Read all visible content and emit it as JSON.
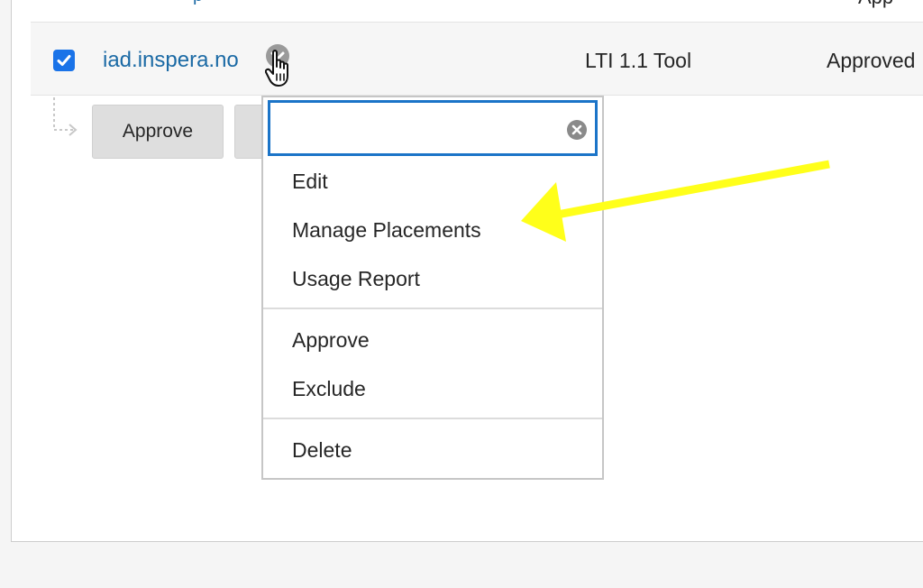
{
  "row": {
    "link_text": "iad.inspera.no",
    "type": "LTI 1.1 Tool",
    "status": "Approved",
    "checked": true
  },
  "actions": {
    "approve_label": "Approve"
  },
  "menu": {
    "search_value": "",
    "items": [
      "Edit",
      "Manage Placements",
      "Usage Report"
    ],
    "status_items": [
      "Approve",
      "Exclude"
    ],
    "danger_items": [
      "Delete"
    ]
  },
  "colors": {
    "link": "#1b6aa5",
    "checkbox": "#1a73e8",
    "focus_border": "#1b74c8",
    "annotation_arrow": "#ffff1a"
  },
  "icons": {
    "checkbox": "checkmark-icon",
    "chevron": "chevron-down-icon",
    "cursor": "hand-pointer-icon",
    "clear": "clear-circle-icon",
    "branch": "branch-arrow-icon",
    "annotation": "annotation-arrow-icon"
  }
}
